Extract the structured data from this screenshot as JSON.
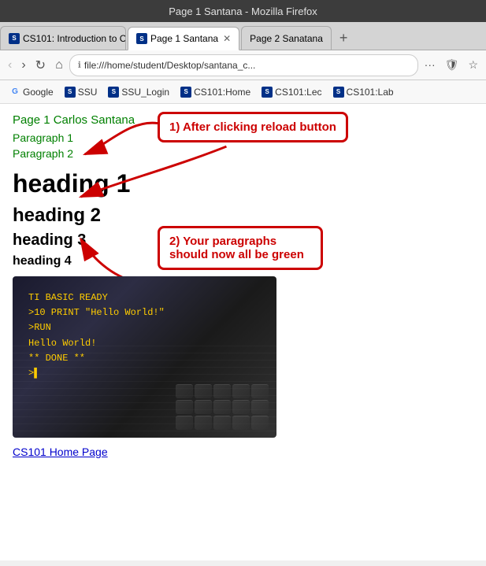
{
  "titleBar": {
    "text": "Page 1 Santana - Mozilla Firefox"
  },
  "tabs": [
    {
      "id": "tab1",
      "label": "CS101: Introduction to C",
      "active": false,
      "icon": "S"
    },
    {
      "id": "tab2",
      "label": "Page 1 Santana",
      "active": true,
      "icon": "S"
    },
    {
      "id": "tab3",
      "label": "Page 2 Sanatana",
      "active": false,
      "icon": ""
    }
  ],
  "navBar": {
    "backBtn": "‹",
    "forwardBtn": "›",
    "reloadBtn": "↻",
    "homeBtn": "⌂",
    "addressText": "file:///home/student/Desktop/santana_c...",
    "moreBtn": "···",
    "shieldBtn": "🛡",
    "starBtn": "☆"
  },
  "bookmarks": [
    {
      "id": "bm-google",
      "label": "Google",
      "icon": "G",
      "iconClass": "bm-g"
    },
    {
      "id": "bm-ssu",
      "label": "SSU",
      "icon": "S",
      "iconClass": "bm-ssu"
    },
    {
      "id": "bm-ssu-login",
      "label": "SSU_Login",
      "icon": "S",
      "iconClass": "bm-ssu"
    },
    {
      "id": "bm-cs101-home",
      "label": "CS101:Home",
      "icon": "S",
      "iconClass": "bm-ssu"
    },
    {
      "id": "bm-cs101-lec",
      "label": "CS101:Lec",
      "icon": "S",
      "iconClass": "bm-ssu"
    },
    {
      "id": "bm-cs101-lab",
      "label": "CS101:Lab",
      "icon": "S",
      "iconClass": "bm-ssu"
    }
  ],
  "page": {
    "title": "Page 1 Carlos Santana",
    "paragraph1": "Paragraph 1",
    "paragraph2": "Paragraph 2",
    "heading1": "heading 1",
    "heading2": "heading 2",
    "heading3": "heading 3",
    "heading4": "heading 4",
    "terminalLines": [
      "TI BASIC READY",
      ">10 PRINT \"Hello World!\"",
      ">RUN",
      "Hello World!",
      "** DONE **",
      ">▌"
    ],
    "link": "CS101 Home Page"
  },
  "callouts": {
    "callout1": "1) After clicking reload button",
    "callout2": "2) Your paragraphs\nshould now all be green"
  }
}
